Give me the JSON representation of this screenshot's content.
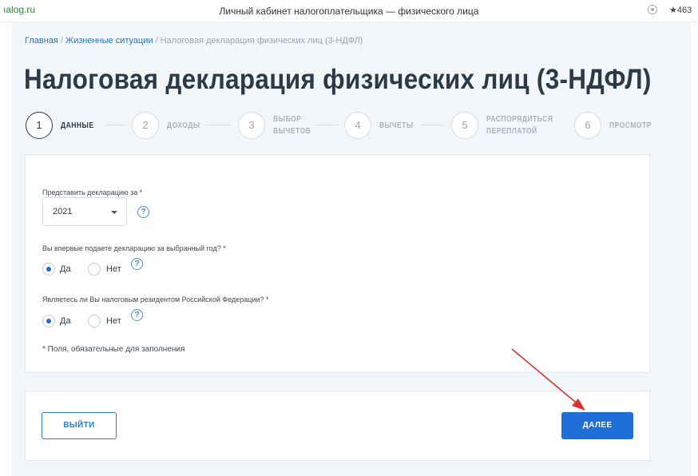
{
  "browser": {
    "host": "ıalog.ru",
    "window_title": "Личный кабинет налогоплательщика — физического лица",
    "rating": "★463"
  },
  "breadcrumb": {
    "items": [
      "Главная",
      "Жизненные ситуации",
      "Налоговая декларация физических лиц (3-НДФЛ)"
    ],
    "separator": "/"
  },
  "page_title": "Налоговая декларация физических лиц (3-НДФЛ)",
  "steps": [
    {
      "num": "1",
      "label": "Данные",
      "active": true
    },
    {
      "num": "2",
      "label": "Доходы",
      "active": false
    },
    {
      "num": "3",
      "label_l1": "Выбор",
      "label_l2": "вычетов",
      "active": false
    },
    {
      "num": "4",
      "label": "Вычеты",
      "active": false
    },
    {
      "num": "5",
      "label_l1": "Распорядиться",
      "label_l2": "переплатой",
      "active": false
    },
    {
      "num": "6",
      "label": "Просмотр",
      "active": false
    }
  ],
  "form": {
    "year_question": "Представить декларацию за *",
    "year_value": "2021",
    "first_time_question": "Вы впервые подаете декларацию за выбранный год? *",
    "resident_question": "Являетесь ли Вы налоговым резидентом Российской Федерации? *",
    "option_yes": "Да",
    "option_no": "Нет",
    "first_time_selected": "Да",
    "resident_selected": "Да",
    "help_symbol": "?",
    "required_note": "* Поля, обязательные для заполнения"
  },
  "actions": {
    "exit_label": "ВЫЙТИ",
    "next_label": "ДАЛЕЕ"
  },
  "colors": {
    "accent": "#1f6fd8",
    "link": "#2b74b8",
    "annotation_arrow": "#d9342b"
  }
}
